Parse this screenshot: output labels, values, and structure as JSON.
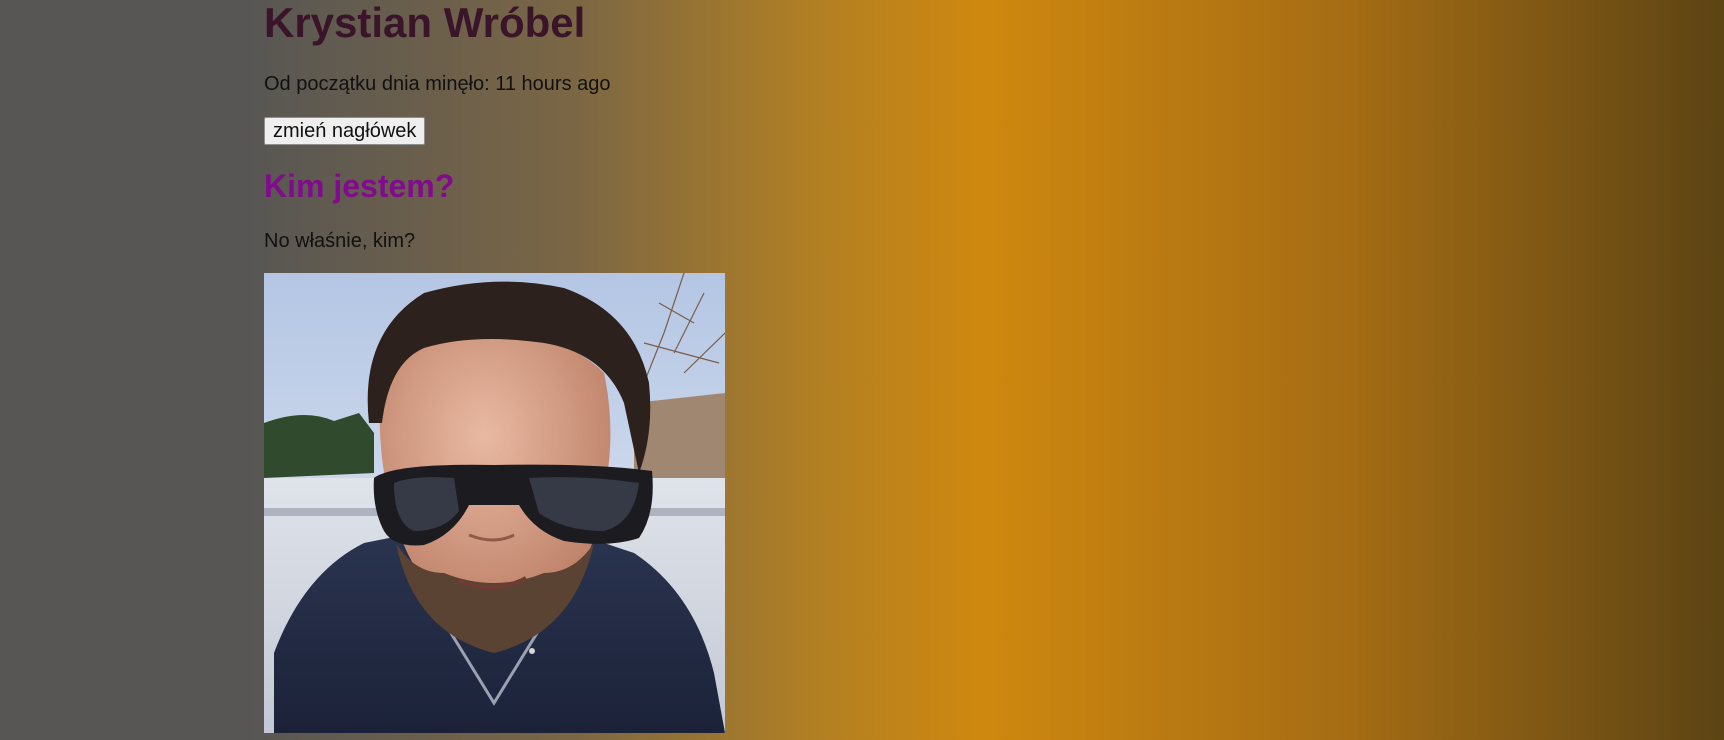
{
  "header": {
    "name": "Krystian Wróbel",
    "elapsed_text": "Od początku dnia minęło: 11 hours ago",
    "change_button_label": "zmień nagłówek"
  },
  "about": {
    "title": "Kim jestem?",
    "text": "No właśnie, kim?"
  },
  "colors": {
    "name": "#3a1429",
    "section_title": "#820a8e",
    "gradient_left": "#575654",
    "gradient_center": "#cf880f",
    "gradient_right": "#5c4414"
  }
}
